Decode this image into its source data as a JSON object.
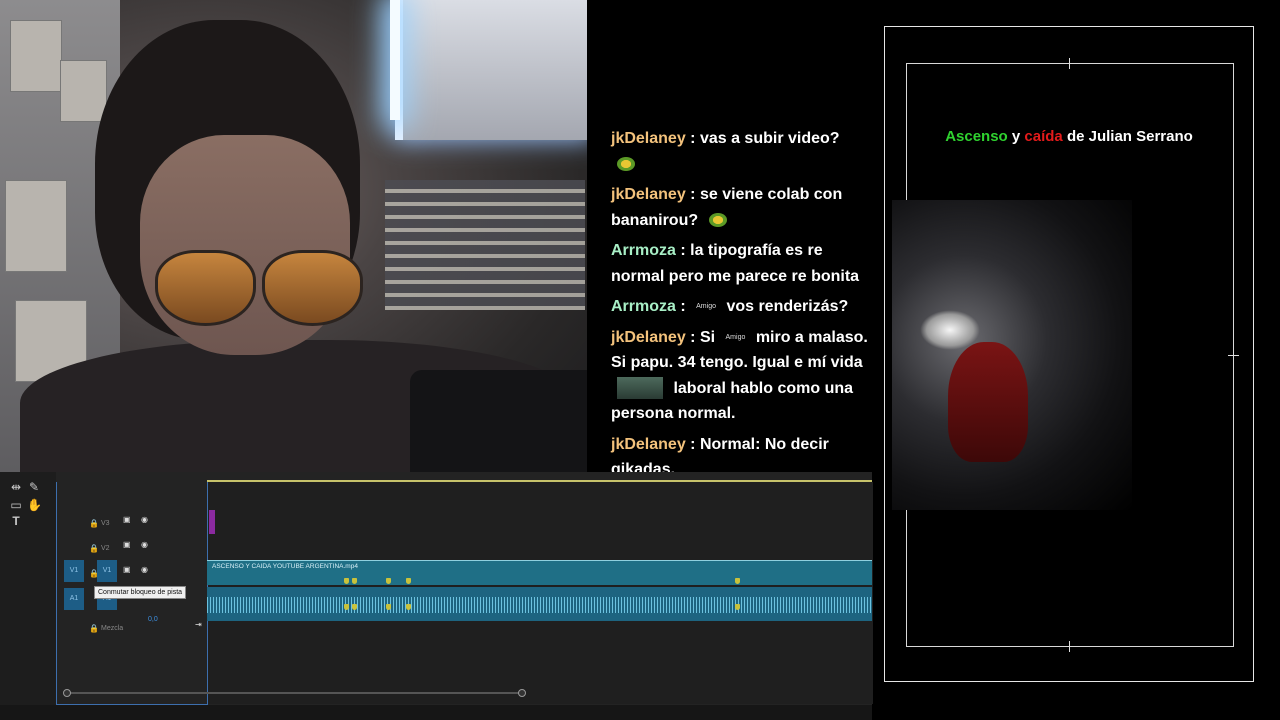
{
  "chat": [
    {
      "user": "jkDelaney",
      "color": "#f3c27c",
      "parts": [
        ": vas a subir video?"
      ],
      "emote": "pepe-emote"
    },
    {
      "user": "jkDelaney",
      "color": "#f3c27c",
      "parts": [
        ": se viene colab con bananirou?"
      ],
      "emote": "pepe-emote"
    },
    {
      "user": "Arrmoza",
      "color": "#a8efc6",
      "parts": [
        ": la tipografía es re normal pero me parece re bonita"
      ]
    },
    {
      "user": "Arrmoza",
      "color": "#a8efc6",
      "parts": [
        ":",
        "Amigo",
        "vos renderizás?"
      ]
    },
    {
      "user": "jkDelaney",
      "color": "#f3c27c",
      "parts": [
        ": Si",
        "Amigo",
        "miro a malaso. Si papu. 34 tengo. Igual e mí vida",
        "",
        "laboral hablo como una persona normal."
      ]
    },
    {
      "user": "jkDelaney",
      "color": "#f3c27c",
      "parts": [
        ": Normal: No decir gikadas."
      ]
    }
  ],
  "timeline": {
    "tracks": [
      {
        "name": "V3"
      },
      {
        "name": "V2"
      },
      {
        "name": "V1",
        "source": "V1"
      },
      {
        "name": "A1",
        "source": "A1"
      }
    ],
    "mix_label": "Mezcla",
    "mix_value": "0,0",
    "clip_name": "ASCENSO Y CAIDA YOUTUBE ARGENTINA.mp4",
    "tooltip": "Conmutar bloqueo de pista"
  },
  "preview": {
    "title_w1": "Ascenso",
    "title_w2": "y",
    "title_w3": "caída",
    "title_rest": "de Julian Serrano",
    "green": "#2fd12f",
    "red": "#e41b1b"
  }
}
